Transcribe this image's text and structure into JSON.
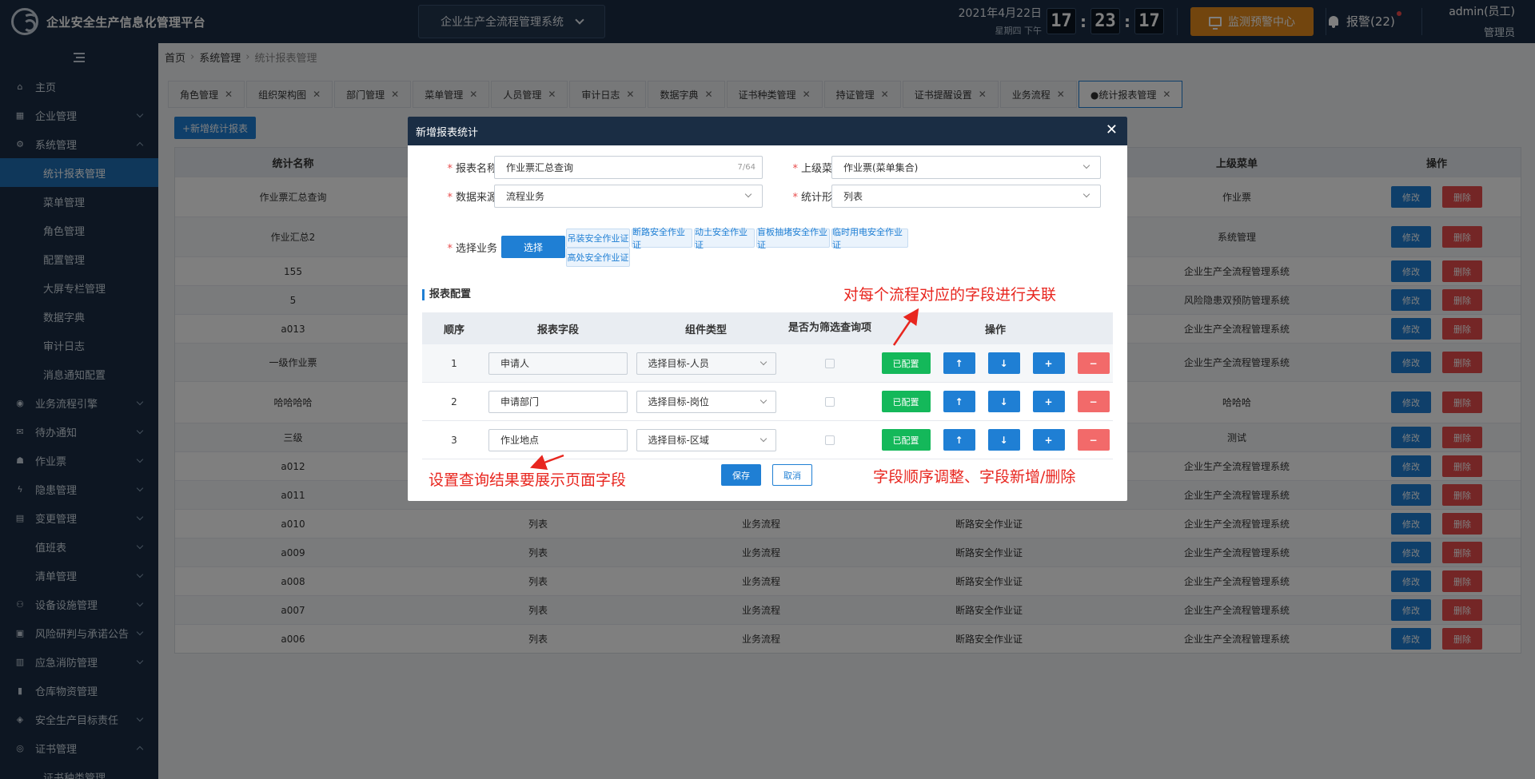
{
  "header": {
    "platform_title": "企业安全生产信息化管理平台",
    "system_select": "企业生产全流程管理系统",
    "date": "2021年4月22日",
    "weekday": "星期四 下午",
    "clock": {
      "h": "17",
      "m": "23",
      "s": "17"
    },
    "monitor_button": "监测预警中心",
    "alarm": "报警(22)",
    "user_name": "admin(员工)",
    "user_role": "管理员"
  },
  "sidebar": {
    "items": [
      {
        "label": "主页",
        "icon": "home-icon",
        "glyph": "⌂",
        "arrow": "none"
      },
      {
        "label": "企业管理",
        "icon": "building-icon",
        "glyph": "▦",
        "arrow": "down"
      },
      {
        "label": "系统管理",
        "icon": "gear-icon",
        "glyph": "⚙",
        "arrow": "up"
      },
      {
        "label": "业务流程引擎",
        "icon": "flow-icon",
        "glyph": "◉",
        "arrow": "down"
      },
      {
        "label": "待办通知",
        "icon": "mail-icon",
        "glyph": "✉",
        "arrow": "down"
      },
      {
        "label": "作业票",
        "icon": "ticket-icon",
        "glyph": "☗",
        "arrow": "down"
      },
      {
        "label": "隐患管理",
        "icon": "bolt-icon",
        "glyph": "ϟ",
        "arrow": "down"
      },
      {
        "label": "变更管理",
        "icon": "clipboard-icon",
        "glyph": "▤",
        "arrow": "down"
      },
      {
        "label": "值班表",
        "icon": "",
        "glyph": "",
        "arrow": "down"
      },
      {
        "label": "清单管理",
        "icon": "",
        "glyph": "",
        "arrow": "down"
      },
      {
        "label": "设备设施管理",
        "icon": "sitemap-icon",
        "glyph": "⚇",
        "arrow": "down"
      },
      {
        "label": "风险研判与承诺公告",
        "icon": "briefcase-icon",
        "glyph": "▣",
        "arrow": "down"
      },
      {
        "label": "应急消防管理",
        "icon": "extinguisher-icon",
        "glyph": "▥",
        "arrow": "down"
      },
      {
        "label": "仓库物资管理",
        "icon": "book-icon",
        "glyph": "▮",
        "arrow": "none"
      },
      {
        "label": "安全生产目标责任",
        "icon": "target-icon",
        "glyph": "◈",
        "arrow": "down"
      },
      {
        "label": "证书管理",
        "icon": "certificate-icon",
        "glyph": "◎",
        "arrow": "up"
      }
    ],
    "system_submenu": [
      "统计报表管理",
      "菜单管理",
      "角色管理",
      "配置管理",
      "大屏专栏管理",
      "数据字典",
      "审计日志",
      "消息通知配置"
    ],
    "cert_submenu": [
      "证书种类管理"
    ]
  },
  "breadcrumb": [
    "首页",
    "系统管理",
    "统计报表管理"
  ],
  "tabs": [
    "角色管理",
    "组织架构图",
    "部门管理",
    "菜单管理",
    "人员管理",
    "审计日志",
    "数据字典",
    "证书种类管理",
    "持证管理",
    "证书提醒设置",
    "业务流程",
    "●统计报表管理"
  ],
  "toolbar": {
    "add_label": "+新增统计报表"
  },
  "grid": {
    "columns": [
      "统计名称",
      "",
      "",
      "",
      "上级菜单",
      "操作"
    ],
    "edit_label": "修改",
    "delete_label": "删除",
    "rows": [
      [
        "作业票汇总查询",
        "",
        "",
        "",
        "作业票"
      ],
      [
        "作业汇总2",
        "",
        "",
        "",
        "系统管理"
      ],
      [
        "155",
        "",
        "",
        "",
        "企业生产全流程管理系统"
      ],
      [
        "5",
        "",
        "",
        "",
        "风险隐患双预防管理系统"
      ],
      [
        "a013",
        "",
        "",
        "",
        "企业生产全流程管理系统"
      ],
      [
        "一级作业票",
        "",
        "",
        "",
        "企业生产全流程管理系统"
      ],
      [
        "哈哈哈哈",
        "",
        "",
        "",
        "哈哈哈"
      ],
      [
        "三级",
        "",
        "",
        "",
        "测试"
      ],
      [
        "a012",
        "列表",
        "业务流程",
        "断路安全作业证",
        "企业生产全流程管理系统"
      ],
      [
        "a011",
        "列表",
        "业务流程",
        "断路安全作业证",
        "企业生产全流程管理系统"
      ],
      [
        "a010",
        "列表",
        "业务流程",
        "断路安全作业证",
        "企业生产全流程管理系统"
      ],
      [
        "a009",
        "列表",
        "业务流程",
        "断路安全作业证",
        "企业生产全流程管理系统"
      ],
      [
        "a008",
        "列表",
        "业务流程",
        "断路安全作业证",
        "企业生产全流程管理系统"
      ],
      [
        "a007",
        "列表",
        "业务流程",
        "断路安全作业证",
        "企业生产全流程管理系统"
      ],
      [
        "a006",
        "列表",
        "业务流程",
        "断路安全作业证",
        "企业生产全流程管理系统"
      ]
    ]
  },
  "modal": {
    "title": "新增报表统计",
    "form": {
      "report_name_label": "报表名称",
      "report_name_value": "作业票汇总查询",
      "report_name_count": "7/64",
      "parent_menu_label": "上级菜单",
      "parent_menu_value": "作业票(菜单集合)",
      "data_source_label": "数据来源",
      "data_source_value": "流程业务",
      "stat_form_label": "统计形式",
      "stat_form_value": "列表",
      "business_label": "选择业务",
      "select_button": "选择",
      "business_chips": [
        "吊装安全作业证",
        "断路安全作业证",
        "动土安全作业证",
        "盲板抽堵安全作业证",
        "临时用电安全作业证",
        "高处安全作业证"
      ]
    },
    "config_title": "报表配置",
    "config_columns": {
      "order": "顺序",
      "field": "报表字段",
      "component": "组件类型",
      "filter_line1": "是否为筛选",
      "filter_line2": "查询项",
      "actions": "操作"
    },
    "config_rows": [
      {
        "order": "1",
        "field": "申请人",
        "component": "选择目标-人员"
      },
      {
        "order": "2",
        "field": "申请部门",
        "component": "选择目标-岗位"
      },
      {
        "order": "3",
        "field": "作业地点",
        "component": "选择目标-区域"
      }
    ],
    "configured_label": "已配置",
    "up_label": "↑",
    "down_label": "↓",
    "add_label": "+",
    "remove_label": "−",
    "save_label": "保存",
    "cancel_label": "取消"
  },
  "annotations": {
    "relate_fields": "对每个流程对应的字段进行关联",
    "display_fields": "设置查询结果要展示页面字段",
    "order_fields": "字段顺序调整、字段新增/删除"
  },
  "colors": {
    "accent": "#1f7fd4",
    "dark": "#1a2d44",
    "danger": "#e84c4c",
    "success": "#14b85a",
    "warning": "#e48a1c",
    "annotation": "#e8261f"
  }
}
